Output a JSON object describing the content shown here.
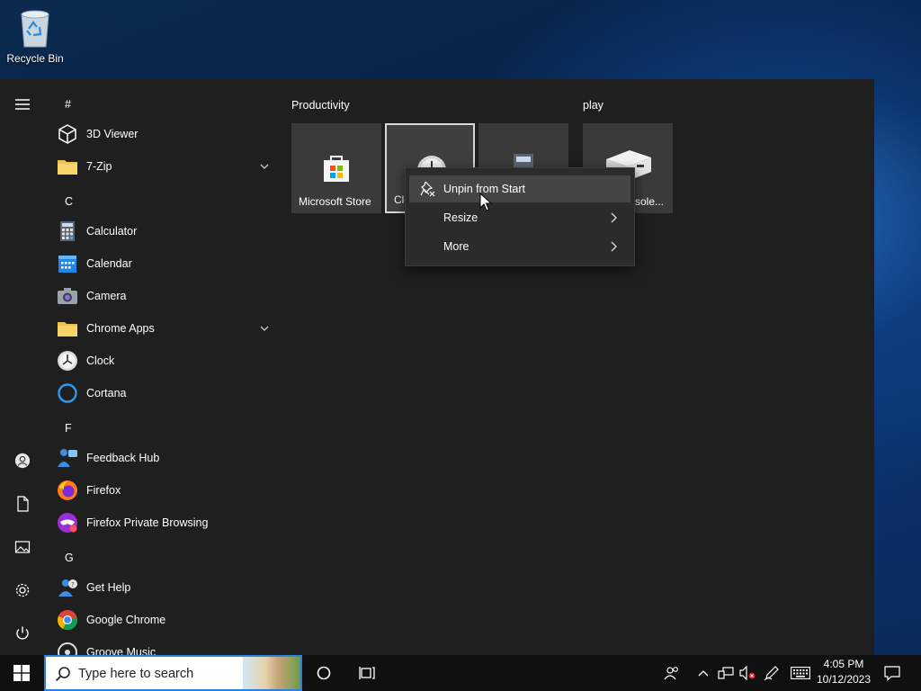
{
  "desktop": {
    "icons": [
      {
        "label": "Recycle Bin",
        "icon": "recycle-bin-icon"
      }
    ]
  },
  "start_menu": {
    "app_list": [
      {
        "type": "letter",
        "text": "#"
      },
      {
        "type": "app",
        "name": "3D Viewer",
        "icon": "3d-viewer-icon"
      },
      {
        "type": "app",
        "name": "7-Zip",
        "icon": "folder-icon",
        "expandable": true
      },
      {
        "type": "letter",
        "text": "C"
      },
      {
        "type": "app",
        "name": "Calculator",
        "icon": "calculator-icon"
      },
      {
        "type": "app",
        "name": "Calendar",
        "icon": "calendar-icon"
      },
      {
        "type": "app",
        "name": "Camera",
        "icon": "camera-icon"
      },
      {
        "type": "app",
        "name": "Chrome Apps",
        "icon": "folder-icon",
        "expandable": true
      },
      {
        "type": "app",
        "name": "Clock",
        "icon": "clock-icon"
      },
      {
        "type": "app",
        "name": "Cortana",
        "icon": "cortana-icon"
      },
      {
        "type": "letter",
        "text": "F"
      },
      {
        "type": "app",
        "name": "Feedback Hub",
        "icon": "feedback-hub-icon"
      },
      {
        "type": "app",
        "name": "Firefox",
        "icon": "firefox-icon"
      },
      {
        "type": "app",
        "name": "Firefox Private Browsing",
        "icon": "firefox-private-icon"
      },
      {
        "type": "letter",
        "text": "G"
      },
      {
        "type": "app",
        "name": "Get Help",
        "icon": "get-help-icon"
      },
      {
        "type": "app",
        "name": "Google Chrome",
        "icon": "chrome-icon"
      },
      {
        "type": "app",
        "name": "Groove Music",
        "icon": "groove-music-icon"
      }
    ],
    "groups": [
      {
        "title": "Productivity",
        "tiles": [
          {
            "label": "Microsoft Store",
            "icon": "store-icon"
          },
          {
            "label": "Clo",
            "icon": "clock-icon",
            "selected": true
          },
          {
            "label": "",
            "icon": "calculator-icon"
          }
        ]
      },
      {
        "title": "play",
        "tiles": [
          {
            "label": "sole...",
            "icon": "console-icon"
          }
        ]
      }
    ]
  },
  "context_menu": {
    "items": [
      {
        "label": "Unpin from Start",
        "icon": "unpin-icon",
        "hover": true
      },
      {
        "label": "Resize",
        "submenu": true
      },
      {
        "label": "More",
        "submenu": true
      }
    ]
  },
  "taskbar": {
    "search_placeholder": "Type here to search",
    "time": "4:05 PM",
    "date": "10/12/2023"
  },
  "colors": {
    "menu_bg": "#1f1f1f",
    "tile_bg": "#3a3a3a",
    "taskbar_bg": "#101010",
    "search_border": "#2f7fe0"
  }
}
